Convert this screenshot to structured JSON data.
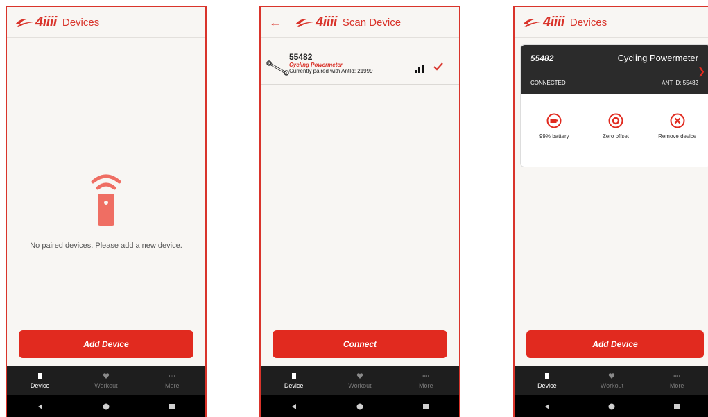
{
  "colors": {
    "accent": "#e12a1f",
    "brand": "#d9342b",
    "nav_bg": "#1e1e1e",
    "card_dark": "#2b2b2b"
  },
  "brand": {
    "logo_text": "4iiii"
  },
  "screen1": {
    "title": "Devices",
    "empty_message": "No paired devices. Please add a new device.",
    "button_label": "Add Device"
  },
  "screen2": {
    "title": "Scan Device",
    "device": {
      "id": "55482",
      "type": "Cycling Powermeter",
      "status": "Currently paired with AntId: 21999"
    },
    "button_label": "Connect"
  },
  "screen3": {
    "title": "Devices",
    "card": {
      "id": "55482",
      "name": "Cycling Powermeter",
      "status": "CONNECTED",
      "ant_id": "ANT ID: 55482"
    },
    "actions": {
      "battery": "99% battery",
      "zero_offset": "Zero offset",
      "remove": "Remove device"
    },
    "button_label": "Add Device"
  },
  "bottom_nav": {
    "items": [
      {
        "label": "Device",
        "icon": "device-icon"
      },
      {
        "label": "Workout",
        "icon": "heart-icon"
      },
      {
        "label": "More",
        "icon": "more-dots-icon"
      }
    ]
  }
}
